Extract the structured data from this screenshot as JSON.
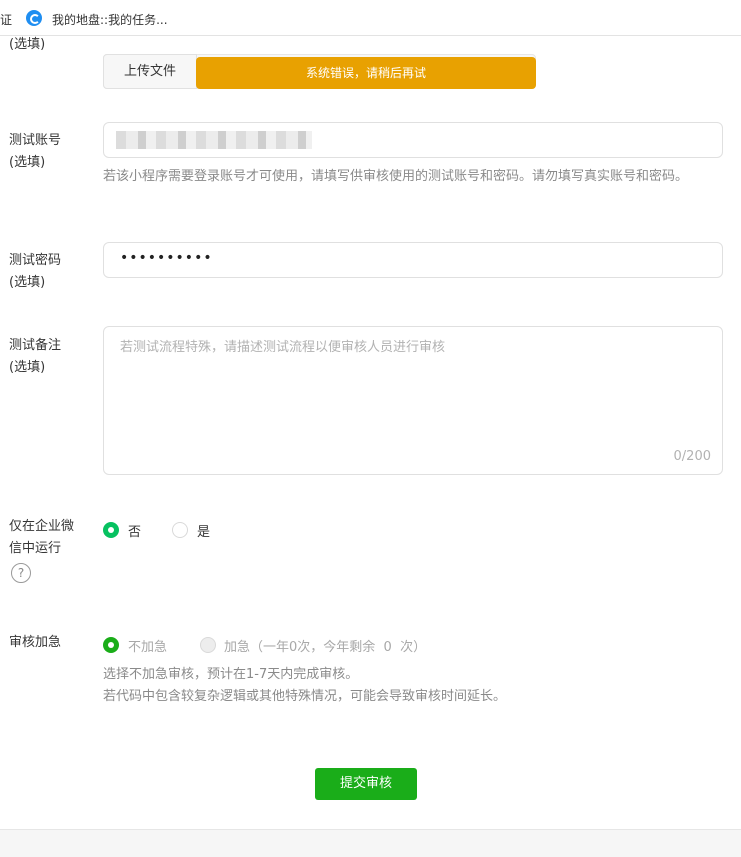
{
  "bookmarks": {
    "item1": "证",
    "item2": "我的地盘::我的任务..."
  },
  "upload": {
    "label_suffix": "(选填)",
    "button_label": "上传文件",
    "error_text": "系统错误，请稍后再试"
  },
  "test_account": {
    "label": "测试账号",
    "label_suffix": "(选填)",
    "hint": "若该小程序需要登录账号才可使用，请填写供审核使用的测试账号和密码。请勿填写真实账号和密码。"
  },
  "test_password": {
    "label": "测试密码",
    "label_suffix": "(选填)",
    "value": "••••••••••"
  },
  "test_notes": {
    "label": "测试备注",
    "label_suffix": "(选填)",
    "placeholder": "若测试流程特殊，请描述测试流程以便审核人员进行审核",
    "counter": "0/200"
  },
  "wecom_only": {
    "label": "仅在企业微信中运行",
    "help_icon_glyph": "?",
    "options": [
      "否",
      "是"
    ],
    "selected": "否"
  },
  "expedite": {
    "label": "审核加急",
    "options": [
      "不加急",
      "加急（一年0次，今年剩余  0  次）"
    ],
    "selected": "不加急",
    "hint_line1": "选择不加急审核，预计在1-7天内完成审核。",
    "hint_line2": "若代码中包含较复杂逻辑或其他特殊情况，可能会导致审核时间延长。"
  },
  "submit": {
    "label": "提交审核"
  },
  "colors": {
    "accent_green": "#07c160",
    "button_green": "#1aad19",
    "error_orange": "#e8a101"
  }
}
